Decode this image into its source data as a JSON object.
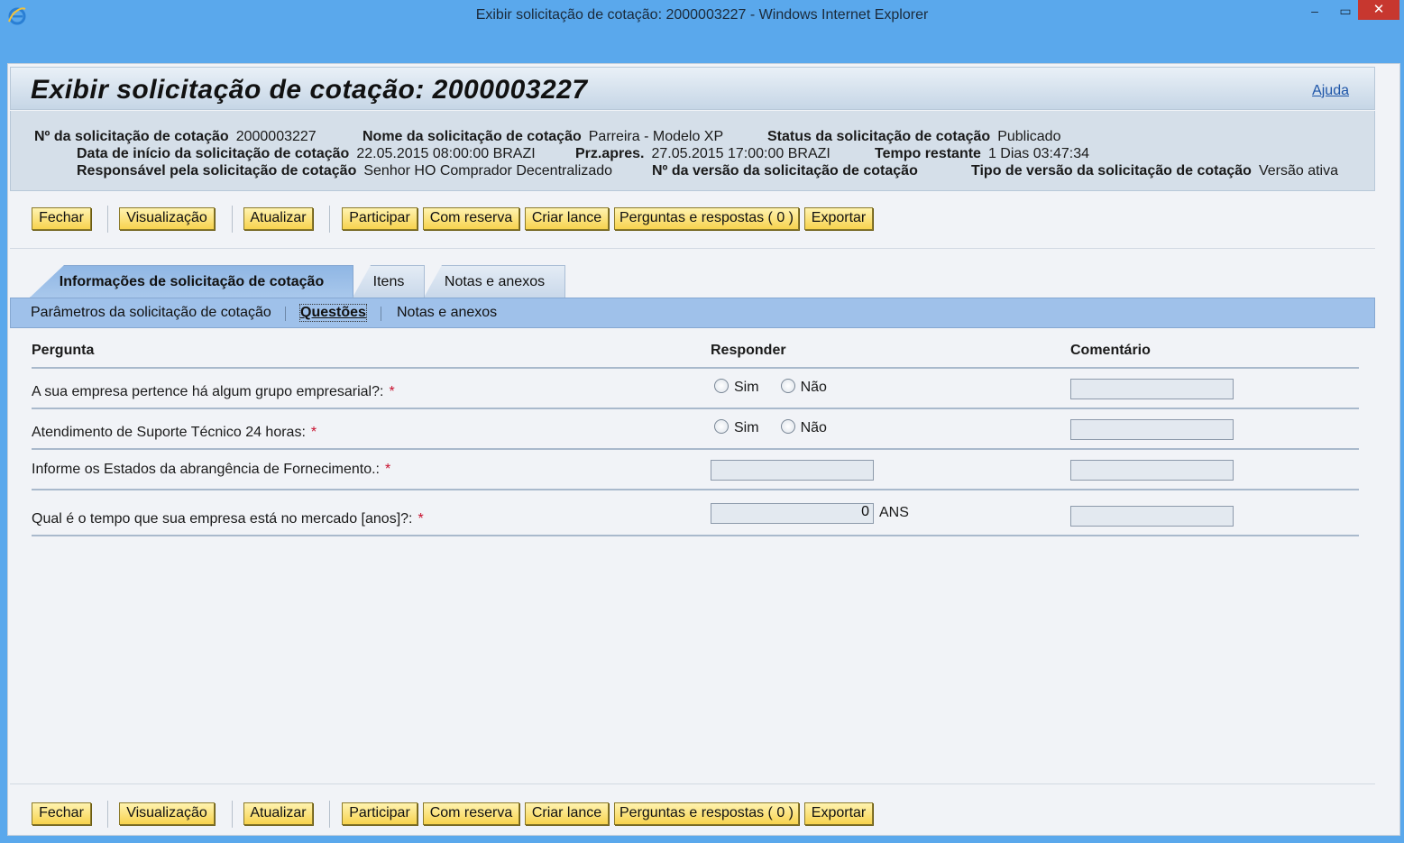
{
  "window": {
    "title": "Exibir solicitação de cotação: 2000003227 - Windows Internet Explorer",
    "minimize": "‒",
    "maximize": "▭",
    "close": "✕"
  },
  "page": {
    "title": "Exibir solicitação de cotação: 2000003227",
    "help": "Ajuda"
  },
  "info": {
    "rfq_no_label": "Nº da solicitação de cotação",
    "rfq_no_value": "2000003227",
    "rfq_name_label": "Nome da solicitação de cotação",
    "rfq_name_value": "Parreira - Modelo XP",
    "status_label": "Status da solicitação de cotação",
    "status_value": "Publicado",
    "start_date_label": "Data de início da solicitação de cotação",
    "start_date_value": "22.05.2015 08:00:00 BRAZI",
    "deadline_label": "Prz.apres.",
    "deadline_value": "27.05.2015 17:00:00 BRAZI",
    "remaining_label": "Tempo restante",
    "remaining_value": "1 Dias 03:47:34",
    "owner_label": "Responsável pela solicitação de cotação",
    "owner_value": "Senhor HO Comprador Decentralizado",
    "version_no_label": "Nº da versão da solicitação de cotação",
    "version_type_label": "Tipo de versão da solicitação de cotação",
    "version_type_value": "Versão ativa"
  },
  "toolbar": {
    "close": "Fechar",
    "preview": "Visualização",
    "refresh": "Atualizar",
    "participate": "Participar",
    "reserve": "Com reserva",
    "create_bid": "Criar lance",
    "qa": "Perguntas e respostas ( 0 )",
    "export": "Exportar"
  },
  "tabs": [
    {
      "label": "Informações de solicitação de cotação"
    },
    {
      "label": "Itens"
    },
    {
      "label": "Notas e anexos"
    }
  ],
  "subtabs": [
    {
      "label": "Parâmetros da solicitação de cotação"
    },
    {
      "label": "Questões"
    },
    {
      "label": "Notas e anexos"
    }
  ],
  "questions": {
    "col_question": "Pergunta",
    "col_answer": "Responder",
    "col_comment": "Comentário",
    "required_mark": "*",
    "yes": "Sim",
    "no": "Não",
    "rows": [
      {
        "text": "A sua empresa pertence há algum grupo empresarial?:"
      },
      {
        "text": "Atendimento de Suporte Técnico 24 horas:"
      },
      {
        "text": "Informe os Estados da abrangência de Fornecimento.:",
        "value": ""
      },
      {
        "text": "Qual é o tempo que sua empresa está no mercado [anos]?:",
        "value": "0",
        "unit": "ANS"
      }
    ]
  }
}
